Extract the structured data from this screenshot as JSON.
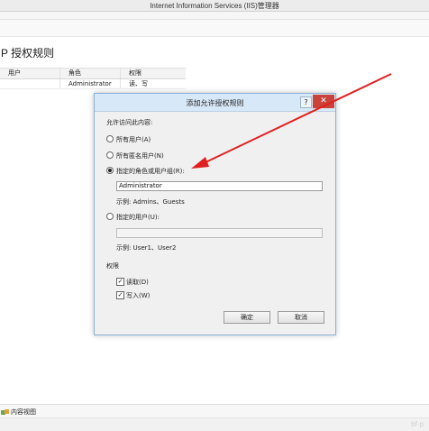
{
  "window": {
    "title": "Internet Information Services (IIS)管理器"
  },
  "page": {
    "title": "P 授权规则"
  },
  "grid": {
    "columns": [
      "用户",
      "角色",
      "权限"
    ],
    "rows": [
      {
        "user": "",
        "role": "Administrator",
        "perm": "读、写"
      }
    ]
  },
  "dialog": {
    "title": "添加允许授权规则",
    "help": "?",
    "close": "✕",
    "access_label": "允许访问此内容:",
    "all_users": "所有用户(A)",
    "anonymous_users": "所有匿名用户(N)",
    "roles_option": "指定的角色或用户组(R):",
    "roles_value": "Administrator",
    "roles_example": "示例: Admins、Guests",
    "users_option": "指定的用户(U):",
    "users_value": "",
    "users_example": "示例: User1、User2",
    "permissions_label": "权限",
    "read": "读取(D)",
    "write": "写入(W)",
    "ok": "确定",
    "cancel": "取消"
  },
  "bottom": {
    "content_view_tab": "内容视图"
  },
  "watermark": "bf·p",
  "colors": {
    "arrow": "#e02020",
    "close": "#c9423b",
    "dialog_border": "#8cb3d7"
  }
}
